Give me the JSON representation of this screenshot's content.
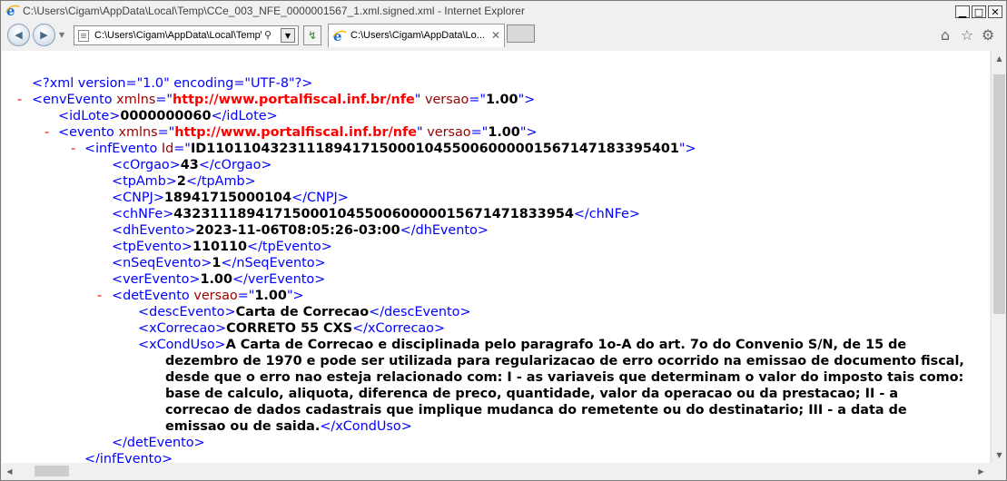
{
  "window": {
    "title": "C:\\Users\\Cigam\\AppData\\Local\\Temp\\CCe_003_NFE_0000001567_1.xml.signed.xml - Internet Explorer",
    "minimize_glyph": "▁",
    "maximize_glyph": "□",
    "close_glyph": "✕"
  },
  "toolbar": {
    "back_glyph": "◀",
    "forward_glyph": "▶",
    "dropdown_glyph": "▼",
    "address": "C:\\Users\\Cigam\\AppData\\Local\\Temp\\C",
    "search_glyph": "⚲",
    "address_dropdown_glyph": "▼",
    "refresh_glyph": "↯",
    "tab_title": "C:\\Users\\Cigam\\AppData\\Lo...",
    "tab_close": "✕",
    "home_glyph": "⌂",
    "favorites_glyph": "☆",
    "tools_glyph": "⚙"
  },
  "xml": {
    "minus": "-",
    "declaration": "<?xml version=\"1.0\" encoding=\"UTF-8\"?>",
    "envEvento": {
      "tag": "envEvento",
      "attr1": "xmlns",
      "ns": "http://www.portalfiscal.inf.br/nfe",
      "attr2": "versao",
      "versao": "1.00"
    },
    "idLote": {
      "tag": "idLote",
      "value": "0000000060"
    },
    "evento": {
      "tag": "evento",
      "attr1": "xmlns",
      "ns": "http://www.portalfiscal.inf.br/nfe",
      "attr2": "versao",
      "versao": "1.00"
    },
    "infEvento": {
      "tag": "infEvento",
      "attr": "Id",
      "id": "ID1101104323111894171500010455006000001567147183395401"
    },
    "cOrgao": {
      "tag": "cOrgao",
      "value": "43"
    },
    "tpAmb": {
      "tag": "tpAmb",
      "value": "2"
    },
    "CNPJ": {
      "tag": "CNPJ",
      "value": "18941715000104"
    },
    "chNFe": {
      "tag": "chNFe",
      "value": "43231118941715000104550060000015671471833954"
    },
    "dhEvento": {
      "tag": "dhEvento",
      "value": "2023-11-06T08:05:26-03:00"
    },
    "tpEvento": {
      "tag": "tpEvento",
      "value": "110110"
    },
    "nSeqEvento": {
      "tag": "nSeqEvento",
      "value": "1"
    },
    "verEvento": {
      "tag": "verEvento",
      "value": "1.00"
    },
    "detEvento": {
      "tag": "detEvento",
      "attr": "versao",
      "versao": "1.00"
    },
    "descEvento": {
      "tag": "descEvento",
      "value": "Carta de Correcao"
    },
    "xCorrecao": {
      "tag": "xCorrecao",
      "value": "CORRETO 55 CXS"
    },
    "xCondUso": {
      "tag": "xCondUso",
      "value": "A Carta de Correcao e disciplinada pelo paragrafo 1o-A do art. 7o do Convenio S/N, de 15 de dezembro de 1970 e pode ser utilizada para regularizacao de erro ocorrido na emissao de documento fiscal, desde que o erro nao esteja relacionado com: I - as variaveis que determinam o valor do imposto tais como: base de calculo, aliquota, diferenca de preco, quantidade, valor da operacao ou da prestacao; II - a correcao de dados cadastrais que implique mudanca do remetente ou do destinatario; III - a data de emissao ou de saida."
    },
    "detEvento_close": "detEvento",
    "infEvento_close": "infEvento"
  },
  "scroll": {
    "up": "▲",
    "down": "▼",
    "left": "◀",
    "right": "▶"
  }
}
